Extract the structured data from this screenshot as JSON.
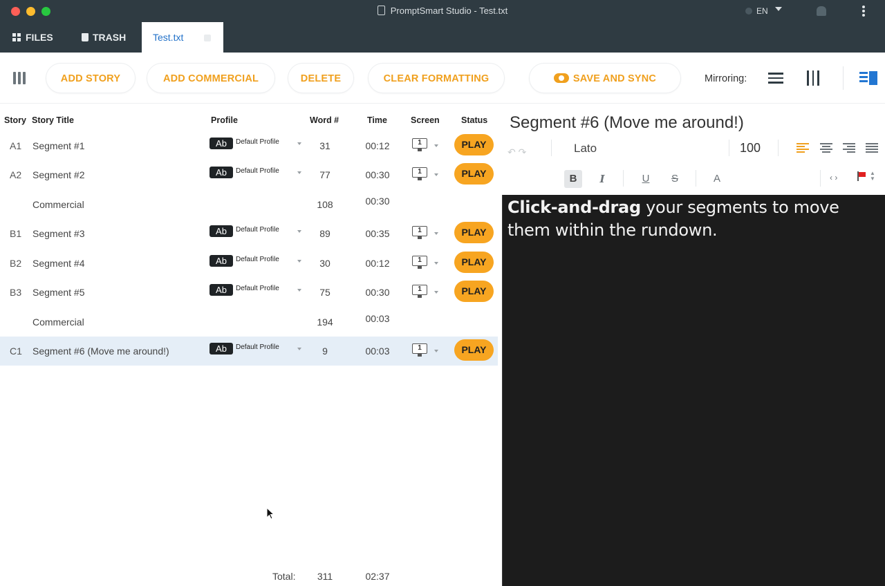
{
  "window": {
    "title": "PromptSmart Studio - Test.txt",
    "language": "EN"
  },
  "tabs": {
    "files": "FILES",
    "trash": "TRASH",
    "active": "Test.txt"
  },
  "toolbar": {
    "add_story": "ADD STORY",
    "add_commercial": "ADD COMMERCIAL",
    "delete": "DELETE",
    "clear_formatting": "CLEAR FORMATTING",
    "save_sync": "SAVE AND SYNC",
    "mirroring_label": "Mirroring:"
  },
  "table": {
    "headers": {
      "story": "Story",
      "title": "Story Title",
      "profile": "Profile",
      "words": "Word #",
      "time": "Time",
      "screen": "Screen",
      "status": "Status"
    },
    "rows": [
      {
        "story": "A1",
        "title": "Segment #1",
        "badge": "Ab",
        "profile": "Default Profile",
        "words": "31",
        "time": "00:12",
        "screen": "1",
        "status": "PLAY"
      },
      {
        "story": "A2",
        "title": "Segment #2",
        "badge": "Ab",
        "profile": "Default Profile",
        "words": "77",
        "time": "00:30",
        "screen": "1",
        "status": "PLAY"
      },
      {
        "story": "",
        "title": "Commercial",
        "words": "108",
        "time": "00:30"
      },
      {
        "story": "B1",
        "title": "Segment #3",
        "badge": "Ab",
        "profile": "Default Profile",
        "words": "89",
        "time": "00:35",
        "screen": "1",
        "status": "PLAY"
      },
      {
        "story": "B2",
        "title": "Segment #4",
        "badge": "Ab",
        "profile": "Default Profile",
        "words": "30",
        "time": "00:12",
        "screen": "1",
        "status": "PLAY"
      },
      {
        "story": "B3",
        "title": "Segment #5",
        "badge": "Ab",
        "profile": "Default Profile",
        "words": "75",
        "time": "00:30",
        "screen": "1",
        "status": "PLAY"
      },
      {
        "story": "",
        "title": "Commercial",
        "words": "194",
        "time": "00:03"
      },
      {
        "story": "C1",
        "title": "Segment #6 (Move me around!)",
        "badge": "Ab",
        "profile": "Default Profile",
        "words": "9",
        "time": "00:03",
        "screen": "1",
        "status": "PLAY"
      }
    ],
    "total": {
      "label": "Total:",
      "words": "311",
      "time": "02:37"
    }
  },
  "editor": {
    "segment_title": "Segment #6 (Move me around!)",
    "font_name": "Lato",
    "font_size": "100",
    "bold_label": "B",
    "italic_label": "I",
    "underline_label": "U",
    "strike_label": "S",
    "color_label": "A",
    "code_label": "‹ ›",
    "text_bold": "Click-and-drag",
    "text_rest": " your segments to move them within the rundown."
  },
  "colors": {
    "accent_orange": "#f7a521",
    "active_blue": "#2372c9",
    "chrome_dark": "#2f3b42"
  }
}
